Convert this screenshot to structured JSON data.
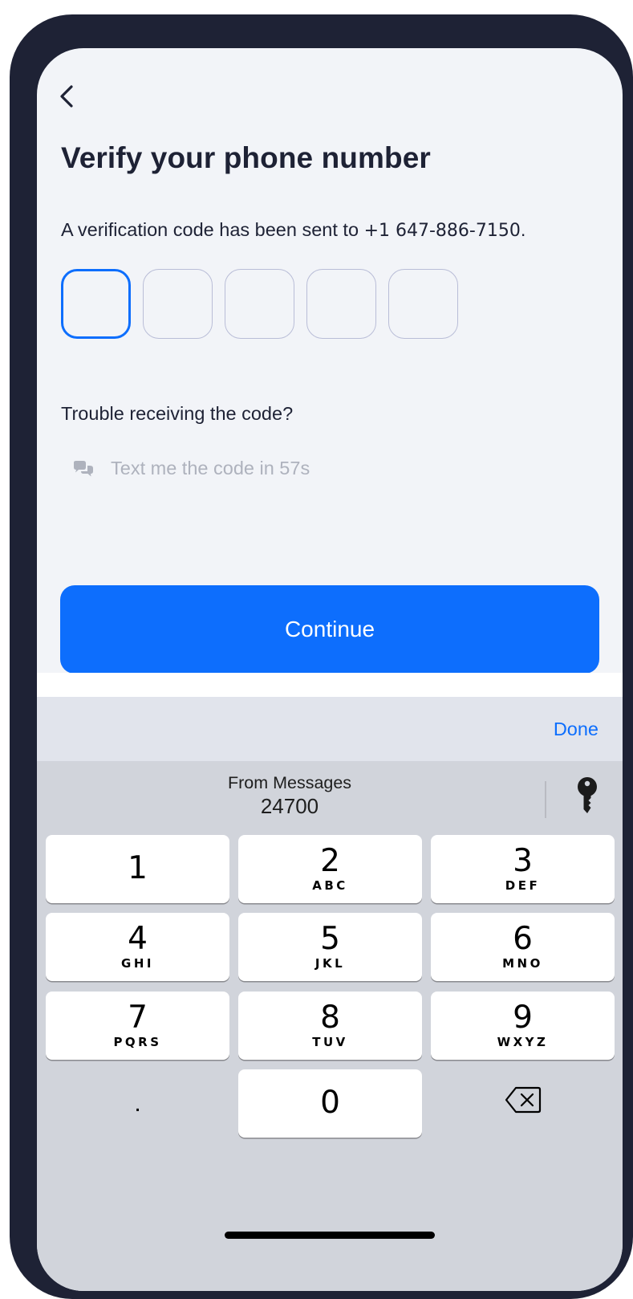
{
  "header": {
    "back_label": "Back",
    "title": "Verify your phone number"
  },
  "verification": {
    "message": "A verification code has been sent to ",
    "phone": "+1 647-886-7150",
    "message_suffix": ".",
    "code_length": 5,
    "code_digits": [
      "",
      "",
      "",
      "",
      ""
    ]
  },
  "help": {
    "trouble_text": "Trouble receiving the code?",
    "resend_text": "Text me the code in 57s"
  },
  "actions": {
    "continue_label": "Continue"
  },
  "keyboard": {
    "done_label": "Done",
    "suggestion_label": "From Messages",
    "suggestion_code": "24700",
    "keys": [
      {
        "digit": "1",
        "letters": ""
      },
      {
        "digit": "2",
        "letters": "ABC"
      },
      {
        "digit": "3",
        "letters": "DEF"
      },
      {
        "digit": "4",
        "letters": "GHI"
      },
      {
        "digit": "5",
        "letters": "JKL"
      },
      {
        "digit": "6",
        "letters": "MNO"
      },
      {
        "digit": "7",
        "letters": "PQRS"
      },
      {
        "digit": "8",
        "letters": "TUV"
      },
      {
        "digit": "9",
        "letters": "WXYZ"
      },
      {
        "digit": "0",
        "letters": ""
      }
    ],
    "dot_key": "."
  },
  "colors": {
    "accent": "#0d6efd",
    "text_primary": "#1e2235",
    "text_muted": "#aeb2bd",
    "background": "#f2f4f8",
    "keyboard_bg": "#d1d4db"
  }
}
